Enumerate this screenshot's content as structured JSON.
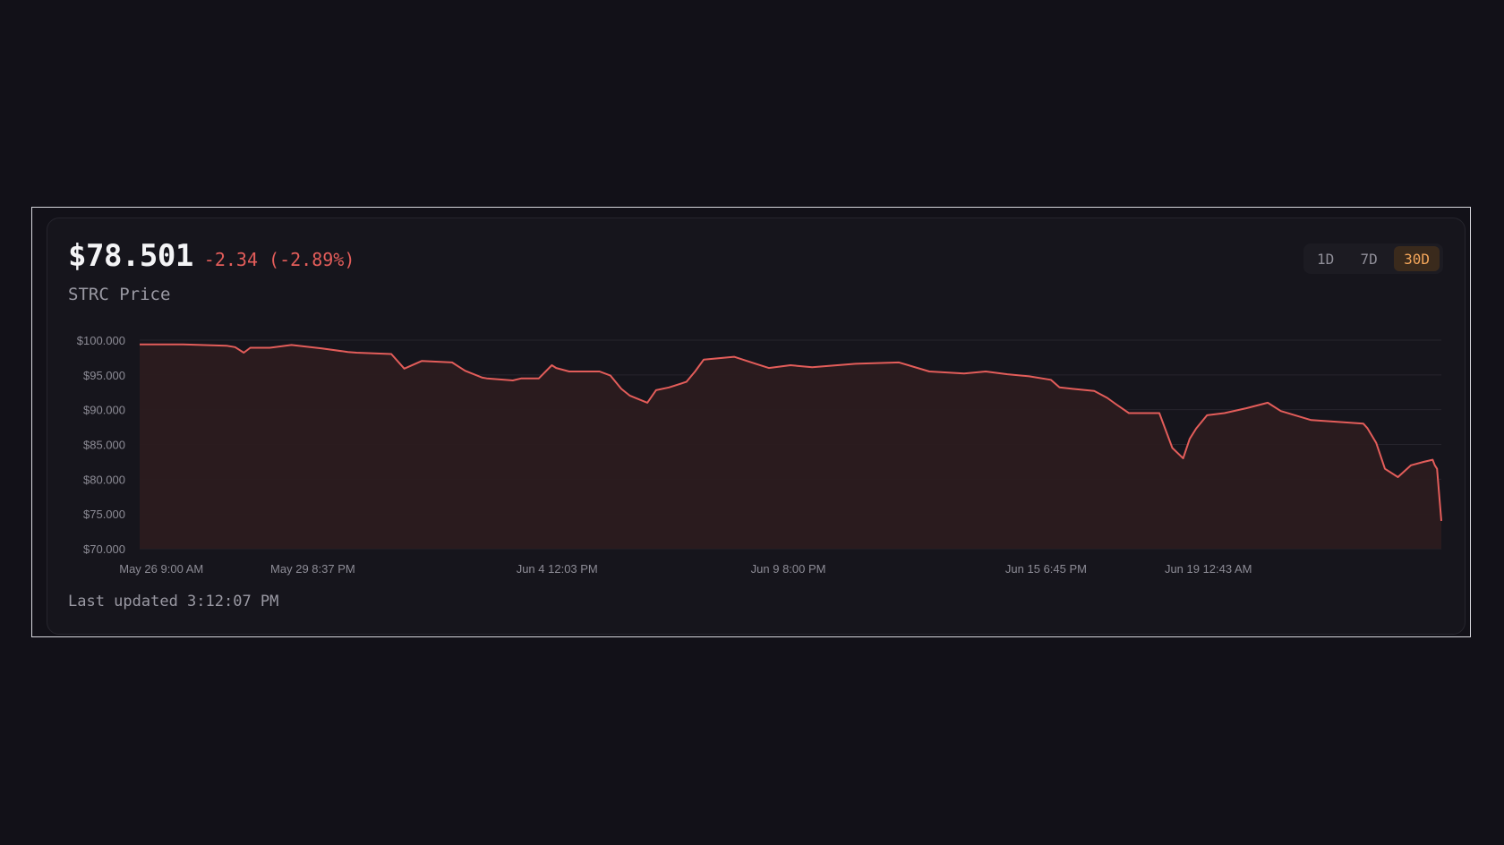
{
  "header": {
    "price": "$78.501",
    "change": "-2.34 (-2.89%)",
    "subtitle": "STRC Price"
  },
  "range_selector": {
    "options": [
      "1D",
      "7D",
      "30D"
    ],
    "selected": "30D"
  },
  "footer": {
    "last_updated": "Last updated 3:12:07 PM"
  },
  "colors": {
    "line": "#e35d5a",
    "area_fill": "#2b1b1f",
    "accent_selected": "#f3a55a",
    "grid": "#26252d",
    "tick_label": "#8d8c96"
  },
  "chart_data": {
    "type": "area",
    "title": "",
    "xlabel": "",
    "ylabel": "",
    "ylim": [
      70,
      100
    ],
    "y_ticks": [
      100,
      95,
      90,
      85,
      80,
      75,
      70
    ],
    "y_tick_labels": [
      "$100.000",
      "$95.000",
      "$90.000",
      "$85.000",
      "$80.000",
      "$75.000",
      "$70.000"
    ],
    "x_range": [
      0,
      30
    ],
    "x_ticks": [
      0.5,
      3.99,
      9.62,
      14.95,
      20.89,
      24.63
    ],
    "x_tick_labels": [
      "May 26 9:00 AM",
      "May 29 8:37 PM",
      "Jun 4 12:03 PM",
      "Jun 9 8:00 PM",
      "Jun 15 6:45 PM",
      "Jun 19 12:43 AM"
    ],
    "grid": "horizontal",
    "legend": "none",
    "series": [
      {
        "x": [
          0,
          1,
          2,
          2.2,
          2.4,
          2.55,
          3,
          3.5,
          4.2,
          4.8,
          5,
          5.8,
          6.1,
          6.5,
          7.2,
          7.5,
          7.9,
          8,
          8.6,
          8.8,
          9.2,
          9.5,
          9.6,
          9.9,
          10.6,
          10.85,
          11.1,
          11.3,
          11.7,
          11.9,
          12.2,
          12.6,
          12.8,
          13,
          13.7,
          14.2,
          14.5,
          15,
          15.5,
          16.5,
          17.5,
          18.2,
          19,
          19.5,
          20,
          20.5,
          21,
          21.2,
          21.5,
          22,
          22.3,
          22.5,
          22.8,
          23.3,
          23.5,
          23.8,
          24.05,
          24.2,
          24.35,
          24.6,
          25,
          25.5,
          26,
          26.3,
          27,
          28.2,
          28.3,
          28.5,
          28.7,
          29,
          29.3,
          29.6,
          29.8,
          29.85,
          29.9,
          30
        ],
        "y": [
          99.4,
          99.4,
          99.2,
          99.0,
          98.2,
          98.9,
          98.9,
          99.3,
          98.8,
          98.3,
          98.2,
          98.0,
          95.9,
          97.0,
          96.8,
          95.6,
          94.6,
          94.5,
          94.2,
          94.5,
          94.5,
          96.4,
          96.0,
          95.5,
          95.5,
          94.9,
          93.0,
          92.0,
          91.0,
          92.8,
          93.2,
          94.0,
          95.5,
          97.2,
          97.6,
          96.6,
          96.0,
          96.4,
          96.1,
          96.6,
          96.8,
          95.5,
          95.2,
          95.5,
          95.1,
          94.8,
          94.3,
          93.2,
          93.0,
          92.7,
          91.7,
          90.8,
          89.5,
          89.5,
          89.5,
          84.5,
          83.0,
          85.8,
          87.3,
          89.2,
          89.5,
          90.2,
          91.0,
          89.8,
          88.5,
          88.0,
          87.3,
          85.2,
          81.5,
          80.3,
          82.0,
          82.5,
          82.8,
          82.0,
          81.5,
          74.0
        ]
      }
    ]
  }
}
